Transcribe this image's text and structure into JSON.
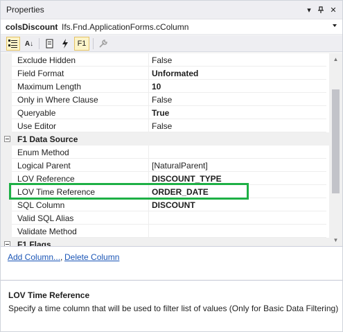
{
  "window": {
    "title": "Properties"
  },
  "titlebar_buttons": [
    {
      "name": "dropdown-arrow-icon",
      "glyph": "▾"
    },
    {
      "name": "pin-icon",
      "glyph": "⊣"
    },
    {
      "name": "close-icon",
      "glyph": "✕"
    }
  ],
  "selector": {
    "object_name": "colsDiscount",
    "object_type": "Ifs.Fnd.ApplicationForms.cColumn"
  },
  "toolbar": {
    "categorized_icon": "▤",
    "alphabetical_icon": "A↓",
    "properties_icon": "▯",
    "events_icon": "⚡",
    "f1_label": "F1",
    "property_pages_icon": "🔧"
  },
  "grid": {
    "rows": [
      {
        "type": "property",
        "name": "Exclude Hidden",
        "value": "False",
        "bold": false
      },
      {
        "type": "property",
        "name": "Field Format",
        "value": "Unformated",
        "bold": true
      },
      {
        "type": "property",
        "name": "Maximum Length",
        "value": "10",
        "bold": true
      },
      {
        "type": "property",
        "name": "Only in Where Clause",
        "value": "False",
        "bold": false
      },
      {
        "type": "property",
        "name": "Queryable",
        "value": "True",
        "bold": true
      },
      {
        "type": "property",
        "name": "Use Editor",
        "value": "False",
        "bold": false
      },
      {
        "type": "category",
        "name": "F1 Data Source"
      },
      {
        "type": "property",
        "name": "Enum Method",
        "value": "",
        "bold": false
      },
      {
        "type": "property",
        "name": "Logical Parent",
        "value": "[NaturalParent]",
        "bold": false
      },
      {
        "type": "property",
        "name": "LOV Reference",
        "value": "DISCOUNT_TYPE",
        "bold": true
      },
      {
        "type": "property",
        "name": "LOV Time Reference",
        "value": "ORDER_DATE",
        "bold": true
      },
      {
        "type": "property",
        "name": "SQL Column",
        "value": "DISCOUNT",
        "bold": true
      },
      {
        "type": "property",
        "name": "Valid SQL Alias",
        "value": "",
        "bold": false
      },
      {
        "type": "property",
        "name": "Validate Method",
        "value": "",
        "bold": false
      },
      {
        "type": "category",
        "name": "F1 Flags"
      }
    ]
  },
  "commands": {
    "add_column": "Add Column...",
    "separator": ",",
    "delete_column": "Delete Column"
  },
  "description": {
    "title": "LOV Time Reference",
    "text": "Specify a time column that will be used to filter list of values (Only for Basic Data Filtering)"
  },
  "colors": {
    "highlight": "#1db045",
    "link": "#1a55b6",
    "active_tool": "#fcf4c9"
  }
}
